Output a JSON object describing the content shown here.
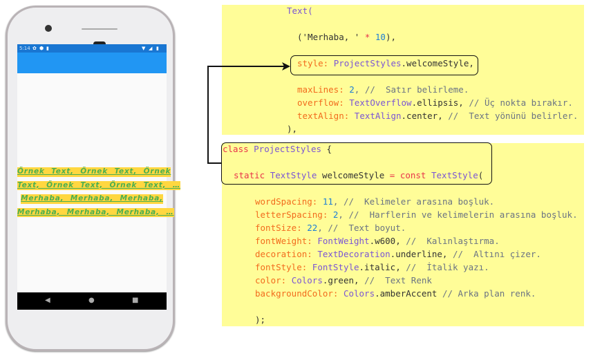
{
  "phone": {
    "status_time": "5:14",
    "status_icons_left": [
      "settings-icon",
      "shield-icon",
      "sd-card-icon"
    ],
    "status_icons_right": [
      "wifi-icon",
      "signal-icon",
      "battery-icon"
    ],
    "appbar_color": "#2196f3",
    "statusbar_color": "#1976d2",
    "text_lines": [
      "Örnek Text, Örnek Text, Örnek",
      "Text, Örnek Text, Örnek Text, …",
      "Merhaba, Merhaba, Merhaba,",
      "Merhaba, Merhaba, Merhaba, …"
    ],
    "text_color": "#4caf50",
    "text_background": "#ffd740",
    "nav": {
      "back": "◀",
      "home": "●",
      "recents": "■"
    }
  },
  "code_block_1": [
    [
      [
        "Text(",
        "cls"
      ]
    ],
    [
      [
        "('Merhaba, ' ",
        "str"
      ],
      [
        "*",
        "kw"
      ],
      [
        " ",
        "pl"
      ],
      [
        "10",
        "num"
      ],
      [
        "),",
        "pl"
      ]
    ],
    [
      [
        "style: ",
        "prop"
      ],
      [
        "ProjectStyles",
        "cls"
      ],
      [
        ".welcomeStyle,",
        "pl"
      ]
    ],
    [
      [
        "maxLines: ",
        "prop"
      ],
      [
        "2",
        "num"
      ],
      [
        ", //  Satır belirleme.",
        "cm"
      ]
    ],
    [
      [
        "overflow: ",
        "prop"
      ],
      [
        "TextOverflow",
        "cls"
      ],
      [
        ".ellipsis, ",
        "pl"
      ],
      [
        "// Üç nokta bırakır.",
        "cm"
      ]
    ],
    [
      [
        "textAlign: ",
        "prop"
      ],
      [
        "TextAlign",
        "cls"
      ],
      [
        ".center, ",
        "pl"
      ],
      [
        "//  Text yönünü belirler.",
        "cm"
      ]
    ],
    [
      [
        "),",
        "pl"
      ]
    ]
  ],
  "code_block_2": [
    [
      [
        "class ",
        "kw"
      ],
      [
        "ProjectStyles",
        "cls"
      ],
      [
        " {",
        "pl"
      ]
    ],
    [
      [
        "static ",
        "kw"
      ],
      [
        "TextStyle",
        "cls"
      ],
      [
        " welcomeStyle ",
        "pl"
      ],
      [
        "= const ",
        "kw"
      ],
      [
        "TextStyle",
        "cls"
      ],
      [
        "(",
        "pl"
      ]
    ],
    [
      [
        "wordSpacing: ",
        "prop"
      ],
      [
        "11",
        "num"
      ],
      [
        ", //  Kelimeler arasına boşluk.",
        "cm"
      ]
    ],
    [
      [
        "letterSpacing: ",
        "prop"
      ],
      [
        "2",
        "num"
      ],
      [
        ", //  Harflerin ve kelimelerin arasına boşluk.",
        "cm"
      ]
    ],
    [
      [
        "fontSize: ",
        "prop"
      ],
      [
        "22",
        "num"
      ],
      [
        ", //  Text boyut.",
        "cm"
      ]
    ],
    [
      [
        "fontWeight: ",
        "prop"
      ],
      [
        "FontWeight",
        "cls"
      ],
      [
        ".w600, ",
        "pl"
      ],
      [
        "//  Kalınlaştırma.",
        "cm"
      ]
    ],
    [
      [
        "decoration: ",
        "prop"
      ],
      [
        "TextDecoration",
        "cls"
      ],
      [
        ".underline, ",
        "pl"
      ],
      [
        "//  Altını çizer.",
        "cm"
      ]
    ],
    [
      [
        "fontStyle: ",
        "prop"
      ],
      [
        "FontStyle",
        "cls"
      ],
      [
        ".italic, ",
        "pl"
      ],
      [
        "//  İtalik yazı.",
        "cm"
      ]
    ],
    [
      [
        "color: ",
        "prop"
      ],
      [
        "Colors",
        "cls"
      ],
      [
        ".green, ",
        "pl"
      ],
      [
        "//  Text Renk",
        "cm"
      ]
    ],
    [
      [
        "backgroundColor: ",
        "prop"
      ],
      [
        "Colors",
        "cls"
      ],
      [
        ".amberAccent ",
        "pl"
      ],
      [
        "// Arka plan renk.",
        "cm"
      ]
    ],
    [
      [
        ");",
        "pl"
      ]
    ]
  ]
}
